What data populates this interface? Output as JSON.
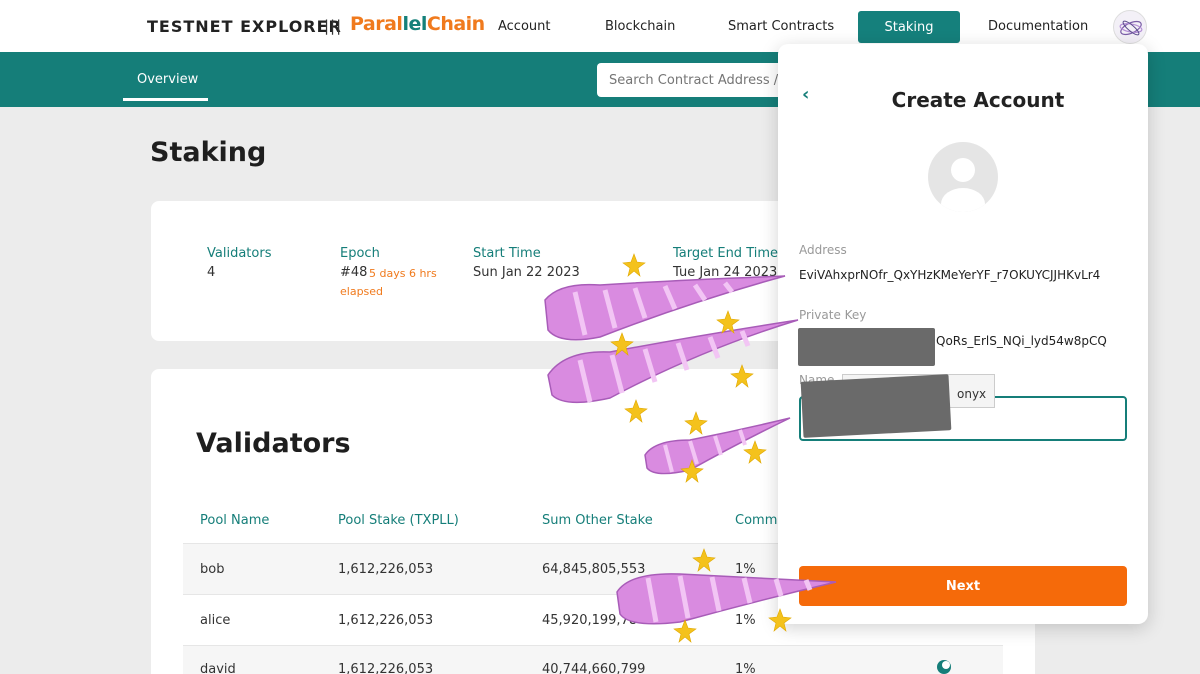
{
  "header": {
    "brand": "TESTNET EXPLORER",
    "separator": "|||",
    "logo_part1": "Paral",
    "logo_part2": "lel",
    "logo_part3": "Chain",
    "nav": [
      "Account",
      "Blockchain",
      "Smart Contracts",
      "Staking",
      "Documentation"
    ],
    "active_nav": "Staking"
  },
  "subnav": {
    "tab": "Overview",
    "search_placeholder": "Search Contract Address / "
  },
  "page": {
    "title": "Staking",
    "stats": {
      "validators_label": "Validators",
      "validators_value": "4",
      "epoch_label": "Epoch",
      "epoch_value": "#48",
      "epoch_elapsed_1": "5 days 6 hrs",
      "epoch_elapsed_2": "elapsed",
      "start_label": "Start Time",
      "start_value": "Sun Jan 22 2023",
      "end_label": "Target End Time",
      "end_value": "Tue Jan 24 2023"
    },
    "validators": {
      "title": "Validators",
      "columns": [
        "Pool Name",
        "Pool Stake (TXPLL)",
        "Sum Other Stake",
        "Comm"
      ],
      "rows": [
        {
          "name": "bob",
          "pool_stake": "1,612,226,053",
          "other_stake": "64,845,805,553",
          "comm": "1%"
        },
        {
          "name": "alice",
          "pool_stake": "1,612,226,053",
          "other_stake": "45,920,199,78",
          "comm": "1%"
        },
        {
          "name": "david",
          "pool_stake": "1,612,226,053",
          "other_stake": "40,744,660,799",
          "comm": "1%"
        }
      ]
    }
  },
  "modal": {
    "back": "‹",
    "title": "Create Account",
    "address_label": "Address",
    "address_value": "EviVAhxprNOfr_QxYHzKMeYerYF_r7OKUYCJJHKvLr4",
    "private_key_label": "Private Key",
    "private_key_visible": "QoRs_ErlS_NQi_lyd54w8pCQ",
    "name_label": "Name",
    "tooltip_text": "onyx",
    "next_label": "Next"
  },
  "colors": {
    "teal": "#157e79",
    "orange": "#f56a0a",
    "sticker_purple": "#d98be0",
    "sticker_star": "#f4c21c"
  },
  "icons": {
    "back": "chevron-left-icon",
    "avatar": "user-avatar-icon",
    "overlay": "unicorn-horn-sticker"
  }
}
